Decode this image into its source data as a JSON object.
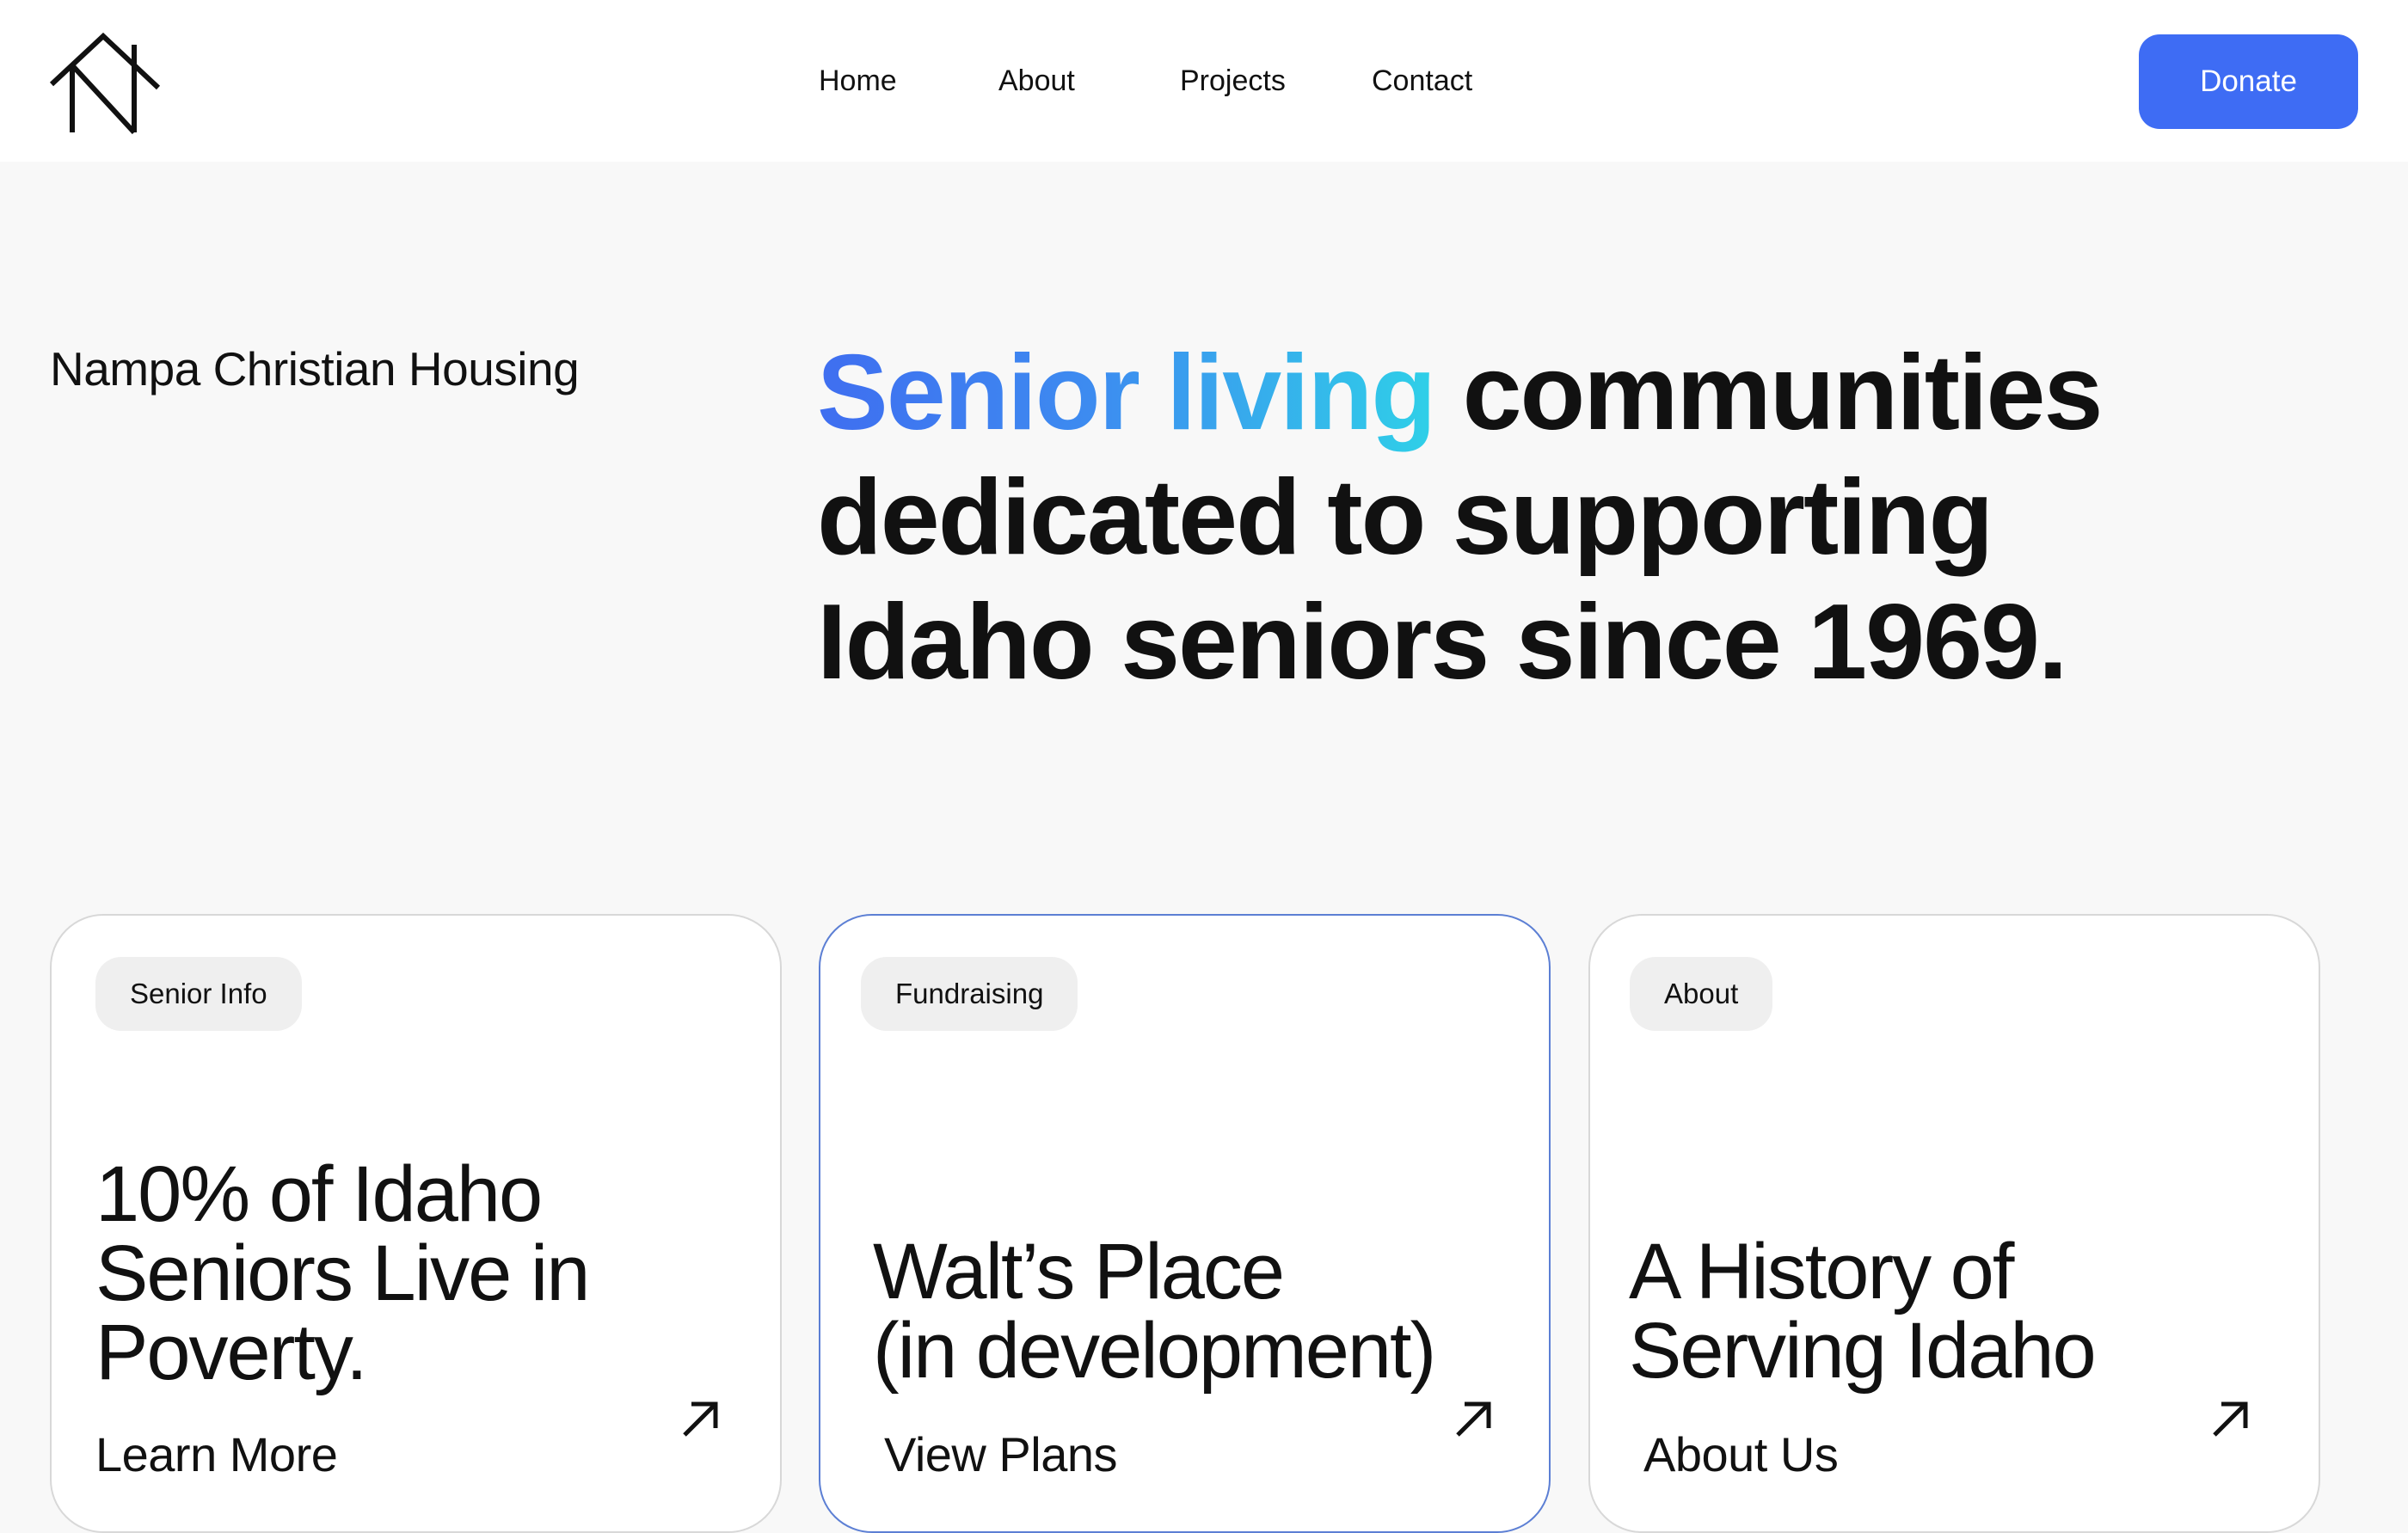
{
  "header": {
    "logo_icon": "house-n-logo-icon",
    "nav": {
      "home": "Home",
      "about": "About",
      "projects": "Projects",
      "contact": "Contact"
    },
    "donate_label": "Donate",
    "donate_color": "#3e6cf4"
  },
  "hero": {
    "org_name": "Nampa Christian Housing",
    "headline_accent": "Senior living",
    "headline_rest": " communities dedicated to supporting Idaho seniors since 1969.",
    "accent_gradient": [
      "#3f6ef0",
      "#2fd0e8"
    ]
  },
  "cards": [
    {
      "tag": "Senior Info",
      "title_lines": [
        "10% of Idaho",
        "Seniors Live in",
        "Poverty."
      ],
      "link": "Learn More",
      "icon": "arrow-up-right-icon"
    },
    {
      "tag": "Fundraising",
      "title_lines": [
        "Walt’s Place",
        "(in development)"
      ],
      "link": "View Plans",
      "icon": "arrow-up-right-icon"
    },
    {
      "tag": "About",
      "title_lines": [
        "A History of",
        "Serving Idaho"
      ],
      "link": "About Us",
      "icon": "arrow-up-right-icon"
    }
  ]
}
